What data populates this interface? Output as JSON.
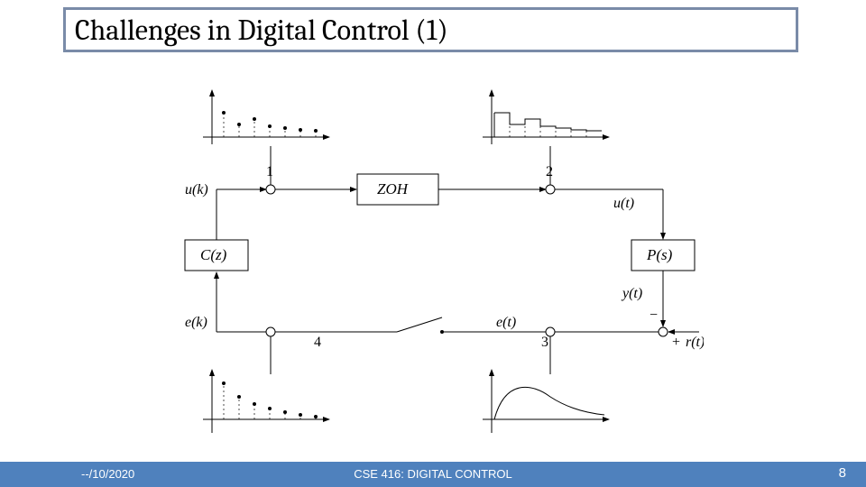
{
  "title": "Challenges in Digital Control (1)",
  "footer": {
    "date": "--/10/2020",
    "course": "CSE 416: DIGITAL CONTROL",
    "page": "8"
  },
  "diagram": {
    "blocks": {
      "zoh": "ZOH",
      "cz": "C(z)",
      "ps": "P(s)"
    },
    "nodes": {
      "n1": "1",
      "n2": "2",
      "n3": "3",
      "n4": "4"
    },
    "signals": {
      "uk": "u(k)",
      "ut": "u(t)",
      "yt": "y(t)",
      "ek": "e(k)",
      "et": "e(t)",
      "rt": "r(t)",
      "minus": "−",
      "plus": "+"
    }
  }
}
